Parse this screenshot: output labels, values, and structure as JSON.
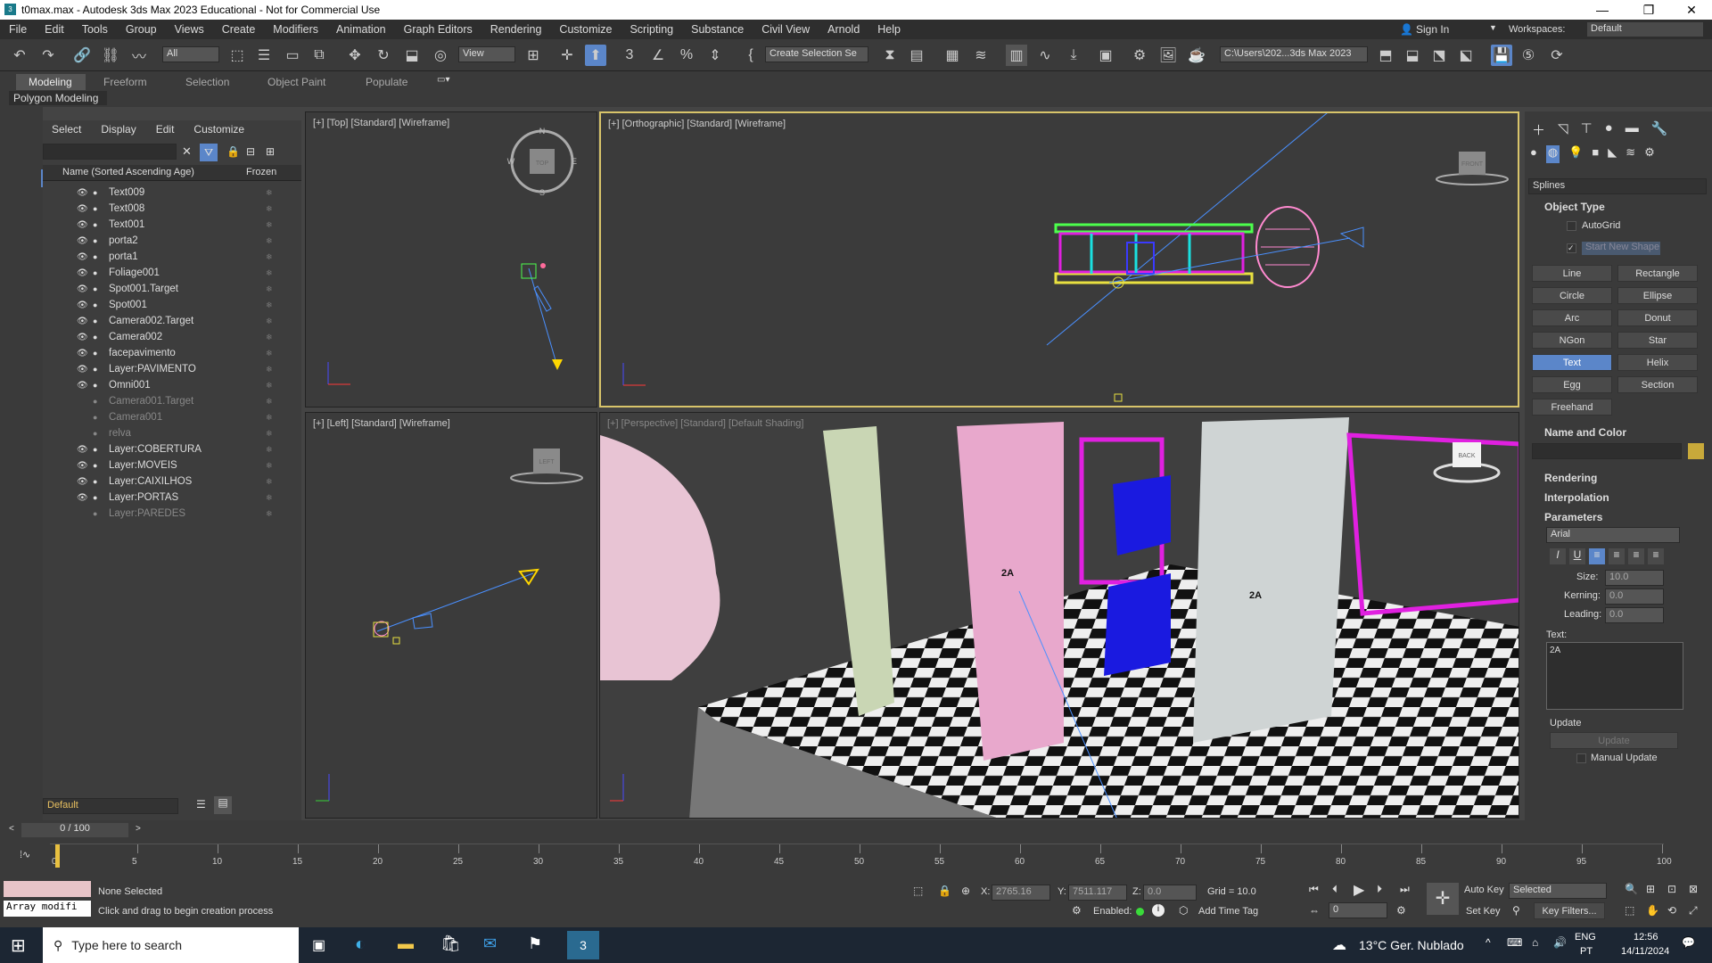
{
  "window": {
    "title": "t0max.max - Autodesk 3ds Max 2023 Educational - Not for Commercial Use",
    "min": "—",
    "max": "❐",
    "close": "✕"
  },
  "menu": [
    "File",
    "Edit",
    "Tools",
    "Group",
    "Views",
    "Create",
    "Modifiers",
    "Animation",
    "Graph Editors",
    "Rendering",
    "Customize",
    "Scripting",
    "Substance",
    "Civil View",
    "Arnold",
    "Help"
  ],
  "account": {
    "signin": "Sign In",
    "workspaces_label": "Workspaces:",
    "workspace": "Default"
  },
  "toolbar": {
    "filter": "All",
    "view": "View",
    "selection_set": "Create Selection Se",
    "path": "C:\\Users\\202...3ds Max 2023"
  },
  "ribbon": {
    "tabs": [
      "Modeling",
      "Freeform",
      "Selection",
      "Object Paint",
      "Populate"
    ],
    "sub": "Polygon Modeling"
  },
  "scene": {
    "menu": [
      "Select",
      "Display",
      "Edit",
      "Customize"
    ],
    "col_name": "Name (Sorted Ascending Age)",
    "col_frozen": "Frozen",
    "items": [
      {
        "name": "Text009",
        "dim": false
      },
      {
        "name": "Text008",
        "dim": false
      },
      {
        "name": "Text001",
        "dim": false
      },
      {
        "name": "porta2",
        "dim": false
      },
      {
        "name": "porta1",
        "dim": false
      },
      {
        "name": "Foliage001",
        "dim": false
      },
      {
        "name": "Spot001.Target",
        "dim": false
      },
      {
        "name": "Spot001",
        "dim": false
      },
      {
        "name": "Camera002.Target",
        "dim": false
      },
      {
        "name": "Camera002",
        "dim": false
      },
      {
        "name": "facepavimento",
        "dim": false
      },
      {
        "name": "Layer:PAVIMENTO",
        "dim": false
      },
      {
        "name": "Omni001",
        "dim": false
      },
      {
        "name": "Camera001.Target",
        "dim": true
      },
      {
        "name": "Camera001",
        "dim": true
      },
      {
        "name": "relva",
        "dim": true
      },
      {
        "name": "Layer:COBERTURA",
        "dim": false
      },
      {
        "name": "Layer:MOVEIS",
        "dim": false
      },
      {
        "name": "Layer:CAIXILHOS",
        "dim": false
      },
      {
        "name": "Layer:PORTAS",
        "dim": false
      },
      {
        "name": "Layer:PAREDES",
        "dim": true
      }
    ],
    "layer": "Default"
  },
  "viewports": {
    "top": "[+] [Top] [Standard] [Wireframe]",
    "ortho": "[+] [Orthographic] [Standard] [Wireframe]",
    "left": "[+] [Left] [Standard] [Wireframe]",
    "persp": "[+] [Perspective] [Standard] [Default Shading]",
    "compass": {
      "n": "N",
      "s": "S",
      "e": "E",
      "w": "W",
      "top": "TOP"
    },
    "cube_front": "FRONT",
    "cube_left": "LEFT",
    "cube_back": "BACK",
    "door_label": "2A"
  },
  "cmd": {
    "category": "Splines",
    "object_type": "Object Type",
    "autogrid": "AutoGrid",
    "start_new": "Start New Shape",
    "buttons": [
      "Line",
      "Rectangle",
      "Circle",
      "Ellipse",
      "Arc",
      "Donut",
      "NGon",
      "Star",
      "Text",
      "Helix",
      "Egg",
      "Section",
      "Freehand"
    ],
    "name_color": "Name and Color",
    "rendering": "Rendering",
    "interpolation": "Interpolation",
    "parameters": "Parameters",
    "font": "Arial",
    "size_label": "Size:",
    "size": "10.0",
    "kerning_label": "Kerning:",
    "kerning": "0.0",
    "leading_label": "Leading:",
    "leading": "0.0",
    "text_label": "Text:",
    "text_value": "2A",
    "update_label": "Update",
    "update_btn": "Update",
    "manual_update": "Manual Update",
    "swatch": "#c8a93a"
  },
  "timeline": {
    "frame": "0 / 100",
    "ticks": [
      "0",
      "5",
      "10",
      "15",
      "20",
      "25",
      "30",
      "35",
      "40",
      "45",
      "50",
      "55",
      "60",
      "65",
      "70",
      "75",
      "80",
      "85",
      "90",
      "95",
      "100"
    ]
  },
  "status": {
    "array": "Array modifi",
    "selection": "None Selected",
    "prompt": "Click and drag to begin creation process",
    "x_label": "X:",
    "x": "2765.16",
    "y_label": "Y:",
    "y": "7511.117",
    "z_label": "Z:",
    "z": "0.0",
    "grid": "Grid = 10.0",
    "enabled": "Enabled:",
    "add_time_tag": "Add Time Tag",
    "auto_key": "Auto Key",
    "selected": "Selected",
    "set_key": "Set Key",
    "key_filters": "Key Filters...",
    "frame_field": "0"
  },
  "taskbar": {
    "search": "Type here to search",
    "weather": "13°C  Ger. Nublado",
    "lang1": "ENG",
    "lang2": "PT",
    "time": "12:56",
    "date": "14/11/2024"
  }
}
